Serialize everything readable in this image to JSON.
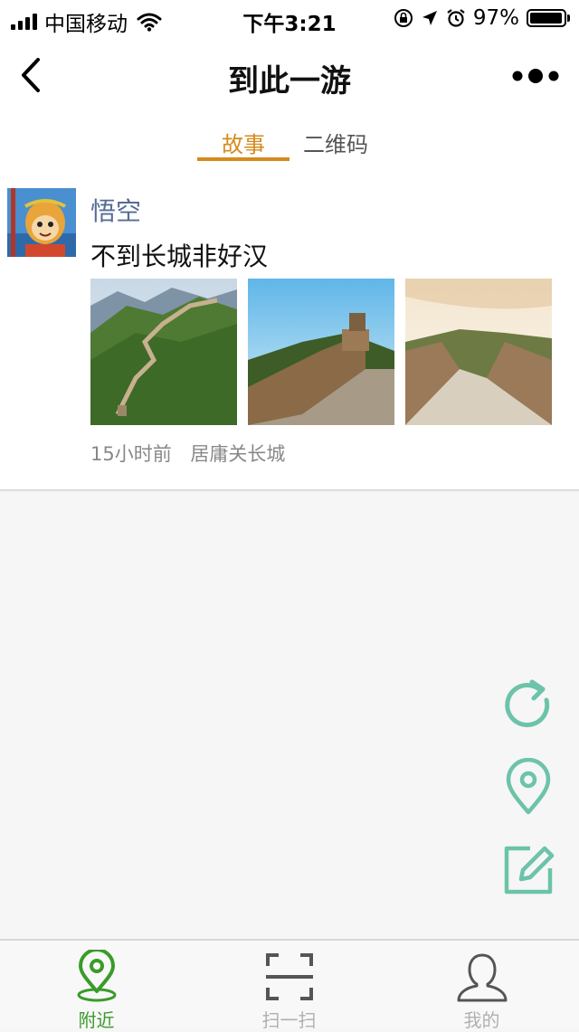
{
  "status_bar": {
    "carrier": "中国移动",
    "time": "下午3:21",
    "battery": "97%",
    "battery_level": 0.97
  },
  "nav": {
    "title": "到此一游",
    "back_icon": "chevron-left-icon",
    "more_icon": "more-icon"
  },
  "tabs": [
    {
      "label": "故事",
      "active": true
    },
    {
      "label": "二维码",
      "active": false
    }
  ],
  "post": {
    "username": "悟空",
    "text": "不到长城非好汉",
    "time_ago": "15小时前",
    "location": "居庸关长城",
    "photo_count": 3
  },
  "fabs": [
    "refresh-icon",
    "location-pin-icon",
    "compose-icon"
  ],
  "tabbar": [
    {
      "label": "附近",
      "icon": "location-pin-icon",
      "active": true
    },
    {
      "label": "扫一扫",
      "icon": "scan-icon",
      "active": false
    },
    {
      "label": "我的",
      "icon": "user-icon",
      "active": false
    }
  ],
  "colors": {
    "accent": "#d58a1c",
    "username": "#576b95",
    "fab": "#6cc3aa",
    "tab_active": "#3a9b2a",
    "tab_inactive": "#b0b0b0"
  }
}
